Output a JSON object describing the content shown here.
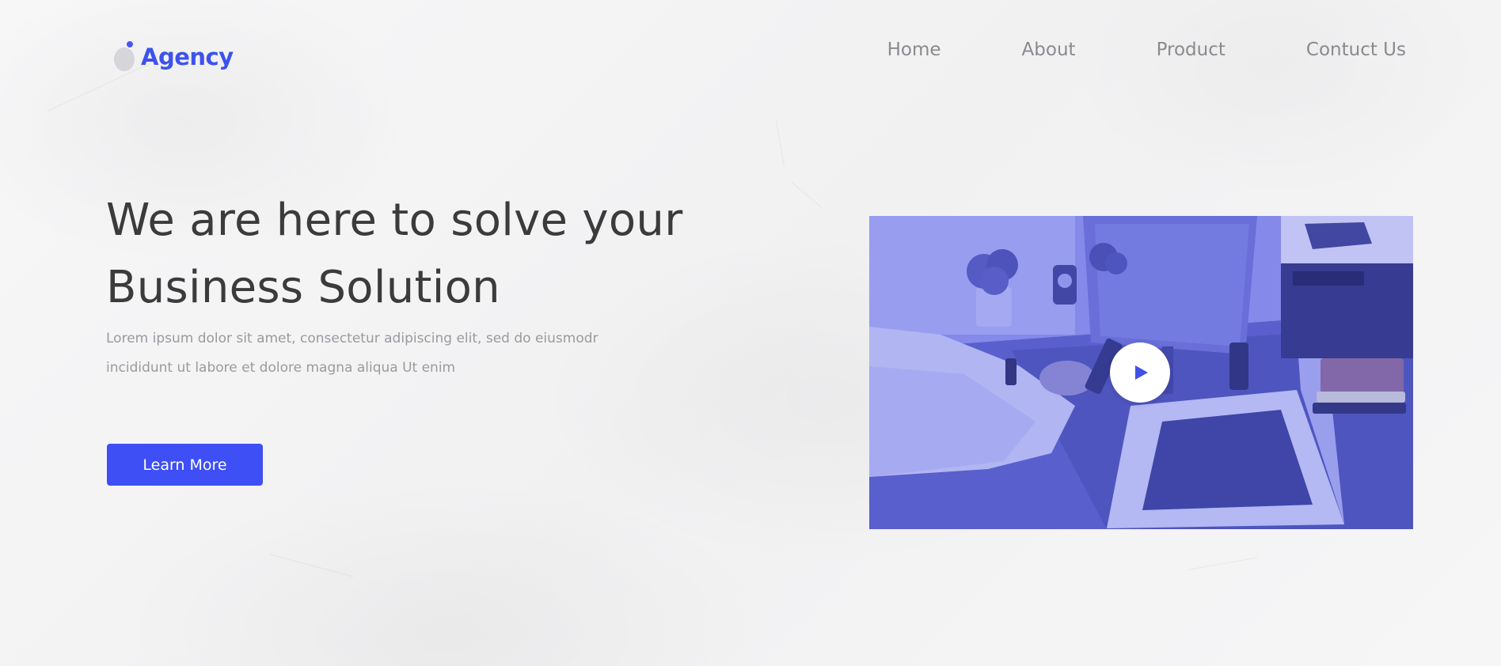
{
  "brand": {
    "name": "Agency",
    "accent_color": "#3e4ff5",
    "logo_icon": "drop-logo-icon"
  },
  "nav": {
    "items": [
      {
        "label": "Home"
      },
      {
        "label": "About"
      },
      {
        "label": "Product"
      },
      {
        "label": "Contuct Us"
      }
    ]
  },
  "hero": {
    "title": "We are here to solve your Business Solution",
    "description": "Lorem ipsum dolor sit amet, consectetur adipiscing elit, sed do eiusmodr incididunt ut labore et dolore magna aliqua Ut enim",
    "cta_label": "Learn More"
  },
  "video": {
    "overlay_color": "#5b62e6",
    "play_icon": "play-icon"
  }
}
